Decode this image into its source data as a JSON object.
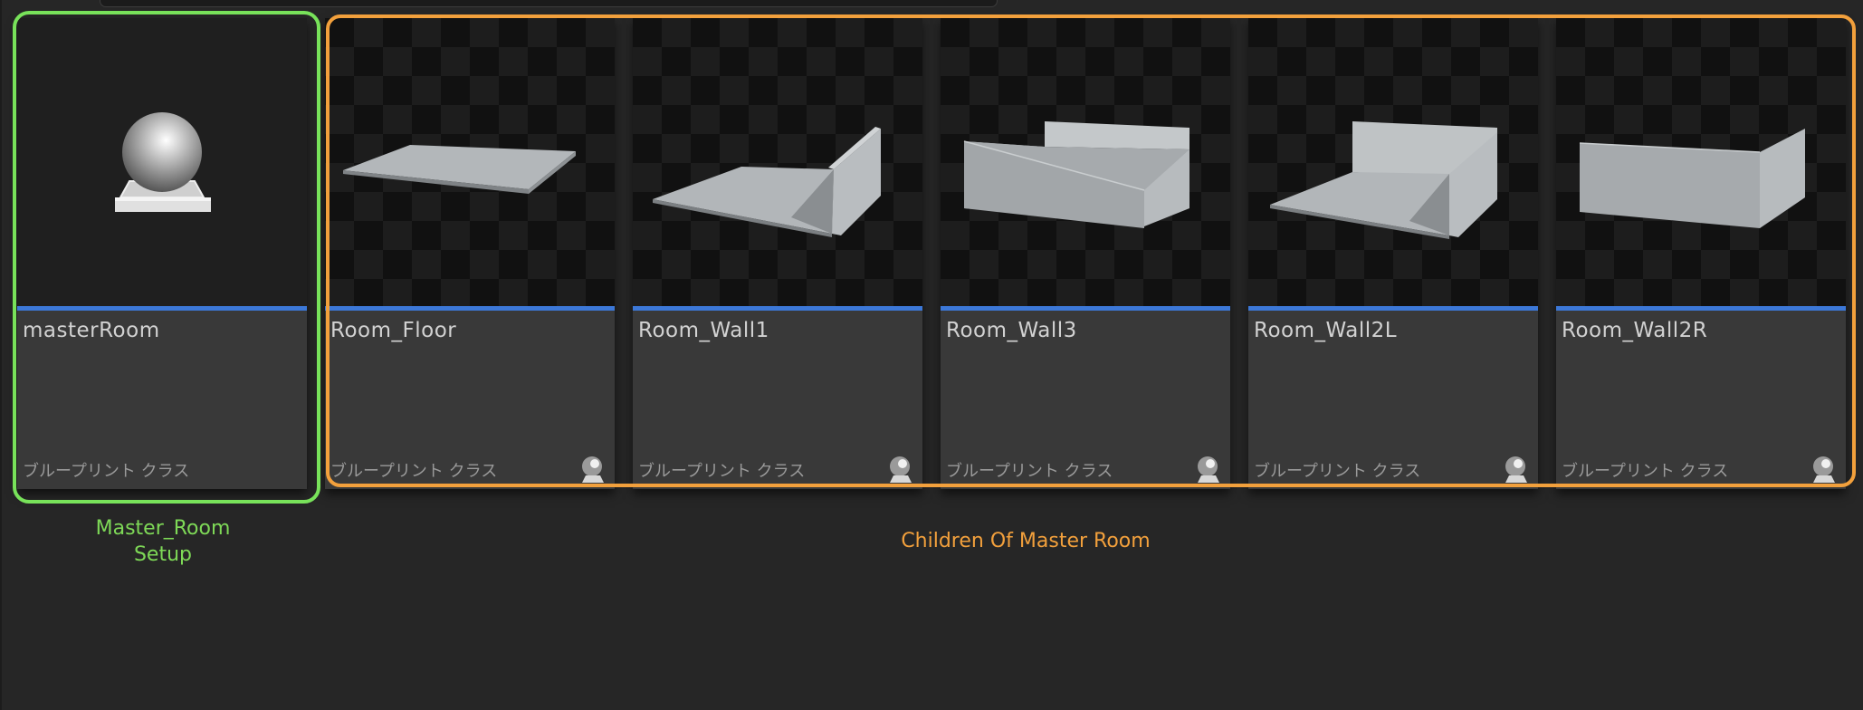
{
  "assets": [
    {
      "name": "masterRoom",
      "type": "ブループリント クラス",
      "thumbnail": "sphere-on-pedestal",
      "has_class_icon": false
    },
    {
      "name": "Room_Floor",
      "type": "ブループリント クラス",
      "thumbnail": "floor",
      "has_class_icon": true
    },
    {
      "name": "Room_Wall1",
      "type": "ブループリント クラス",
      "thumbnail": "floor-with-wall",
      "has_class_icon": true
    },
    {
      "name": "Room_Wall3",
      "type": "ブループリント クラス",
      "thumbnail": "three-walls",
      "has_class_icon": true
    },
    {
      "name": "Room_Wall2L",
      "type": "ブループリント クラス",
      "thumbnail": "floor-two-walls",
      "has_class_icon": true
    },
    {
      "name": "Room_Wall2R",
      "type": "ブループリント クラス",
      "thumbnail": "two-walls",
      "has_class_icon": true
    }
  ],
  "annotations": {
    "master_label": "Master_Room\nSetup",
    "children_label": "Children Of Master Room"
  },
  "colors": {
    "master_outline": "#78e25a",
    "children_outline": "#f2a03c",
    "asset_type_bar": "#3c78d8"
  }
}
